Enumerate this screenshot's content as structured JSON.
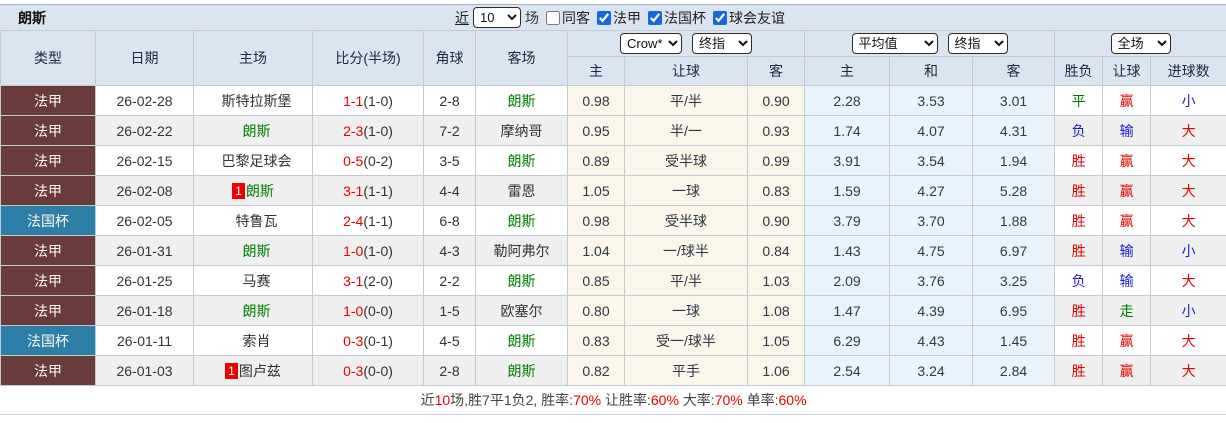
{
  "title": "朗斯",
  "topbar": {
    "recent_label": "近",
    "recent_value": "10",
    "matches_label": "场",
    "checkboxes": [
      {
        "key": "same-away",
        "label": "同客",
        "checked": false
      },
      {
        "key": "ligue-1",
        "label": "法甲",
        "checked": true
      },
      {
        "key": "coupe-de-france",
        "label": "法国杯",
        "checked": true
      },
      {
        "key": "club-friendly",
        "label": "球会友谊",
        "checked": true
      }
    ]
  },
  "selectors": {
    "asian_bookmaker": "Crow*",
    "asian_time": "终指",
    "euro_bookmaker": "平均值",
    "euro_time": "终指",
    "scope": "全场"
  },
  "columns": {
    "main": [
      "类型",
      "日期",
      "主场",
      "比分(半场)",
      "角球",
      "客场"
    ],
    "asian": [
      "主",
      "让球",
      "客"
    ],
    "euro": [
      "主",
      "和",
      "客"
    ],
    "result": [
      "胜负",
      "让球",
      "进球数"
    ]
  },
  "theme": {
    "league_colors": {
      "法甲": "#693b3b",
      "法国杯": "#2e7fa7"
    },
    "result_colors": {
      "red": "#e80000",
      "blue": "#1b1bd0",
      "green": "#007800"
    },
    "header_bg": "#dbe5f1",
    "asian_bg": "#fbf6ea",
    "euro_bg": "#e9f3fb",
    "alt_row_bg": "#efefef"
  },
  "rows": [
    {
      "type": "法甲",
      "date": "26-02-28",
      "home": {
        "name": "斯特拉斯堡",
        "self": false,
        "badge": null
      },
      "score": "1-1",
      "half": "(1-0)",
      "corners": "2-8",
      "away": {
        "name": "朗斯",
        "self": true
      },
      "ah": [
        "0.98",
        "平/半",
        "0.90"
      ],
      "eu": [
        "2.28",
        "3.53",
        "3.01"
      ],
      "res": [
        [
          "平",
          "green"
        ],
        [
          "赢",
          "red"
        ],
        [
          "小",
          "blue"
        ]
      ]
    },
    {
      "type": "法甲",
      "date": "26-02-22",
      "home": {
        "name": "朗斯",
        "self": true,
        "badge": null
      },
      "score": "2-3",
      "half": "(1-0)",
      "corners": "7-2",
      "away": {
        "name": "摩纳哥",
        "self": false
      },
      "ah": [
        "0.95",
        "半/一",
        "0.93"
      ],
      "eu": [
        "1.74",
        "4.07",
        "4.31"
      ],
      "res": [
        [
          "负",
          "blue"
        ],
        [
          "输",
          "blue"
        ],
        [
          "大",
          "red"
        ]
      ]
    },
    {
      "type": "法甲",
      "date": "26-02-15",
      "home": {
        "name": "巴黎足球会",
        "self": false,
        "badge": null
      },
      "score": "0-5",
      "half": "(0-2)",
      "corners": "3-5",
      "away": {
        "name": "朗斯",
        "self": true
      },
      "ah": [
        "0.89",
        "受半球",
        "0.99"
      ],
      "eu": [
        "3.91",
        "3.54",
        "1.94"
      ],
      "res": [
        [
          "胜",
          "red"
        ],
        [
          "赢",
          "red"
        ],
        [
          "大",
          "red"
        ]
      ]
    },
    {
      "type": "法甲",
      "date": "26-02-08",
      "home": {
        "name": "朗斯",
        "self": true,
        "badge": "1"
      },
      "score": "3-1",
      "half": "(1-1)",
      "corners": "4-4",
      "away": {
        "name": "雷恩",
        "self": false
      },
      "ah": [
        "1.05",
        "一球",
        "0.83"
      ],
      "eu": [
        "1.59",
        "4.27",
        "5.28"
      ],
      "res": [
        [
          "胜",
          "red"
        ],
        [
          "赢",
          "red"
        ],
        [
          "大",
          "red"
        ]
      ]
    },
    {
      "type": "法国杯",
      "date": "26-02-05",
      "home": {
        "name": "特鲁瓦",
        "self": false,
        "badge": null
      },
      "score": "2-4",
      "half": "(1-1)",
      "corners": "6-8",
      "away": {
        "name": "朗斯",
        "self": true
      },
      "ah": [
        "0.98",
        "受半球",
        "0.90"
      ],
      "eu": [
        "3.79",
        "3.70",
        "1.88"
      ],
      "res": [
        [
          "胜",
          "red"
        ],
        [
          "赢",
          "red"
        ],
        [
          "大",
          "red"
        ]
      ]
    },
    {
      "type": "法甲",
      "date": "26-01-31",
      "home": {
        "name": "朗斯",
        "self": true,
        "badge": null
      },
      "score": "1-0",
      "half": "(1-0)",
      "corners": "4-3",
      "away": {
        "name": "勒阿弗尔",
        "self": false
      },
      "ah": [
        "1.04",
        "一/球半",
        "0.84"
      ],
      "eu": [
        "1.43",
        "4.75",
        "6.97"
      ],
      "res": [
        [
          "胜",
          "red"
        ],
        [
          "输",
          "blue"
        ],
        [
          "小",
          "blue"
        ]
      ]
    },
    {
      "type": "法甲",
      "date": "26-01-25",
      "home": {
        "name": "马赛",
        "self": false,
        "badge": null
      },
      "score": "3-1",
      "half": "(2-0)",
      "corners": "2-2",
      "away": {
        "name": "朗斯",
        "self": true
      },
      "ah": [
        "0.85",
        "平/半",
        "1.03"
      ],
      "eu": [
        "2.09",
        "3.76",
        "3.25"
      ],
      "res": [
        [
          "负",
          "blue"
        ],
        [
          "输",
          "blue"
        ],
        [
          "大",
          "red"
        ]
      ]
    },
    {
      "type": "法甲",
      "date": "26-01-18",
      "home": {
        "name": "朗斯",
        "self": true,
        "badge": null
      },
      "score": "1-0",
      "half": "(0-0)",
      "corners": "1-5",
      "away": {
        "name": "欧塞尔",
        "self": false
      },
      "ah": [
        "0.80",
        "一球",
        "1.08"
      ],
      "eu": [
        "1.47",
        "4.39",
        "6.95"
      ],
      "res": [
        [
          "胜",
          "red"
        ],
        [
          "走",
          "green"
        ],
        [
          "小",
          "blue"
        ]
      ]
    },
    {
      "type": "法国杯",
      "date": "26-01-11",
      "home": {
        "name": "索肖",
        "self": false,
        "badge": null
      },
      "score": "0-3",
      "half": "(0-1)",
      "corners": "4-5",
      "away": {
        "name": "朗斯",
        "self": true
      },
      "ah": [
        "0.83",
        "受一/球半",
        "1.05"
      ],
      "eu": [
        "6.29",
        "4.43",
        "1.45"
      ],
      "res": [
        [
          "胜",
          "red"
        ],
        [
          "赢",
          "red"
        ],
        [
          "大",
          "red"
        ]
      ]
    },
    {
      "type": "法甲",
      "date": "26-01-03",
      "home": {
        "name": "图卢兹",
        "self": false,
        "badge": "1"
      },
      "score": "0-3",
      "half": "(0-0)",
      "corners": "2-8",
      "away": {
        "name": "朗斯",
        "self": true
      },
      "ah": [
        "0.82",
        "平手",
        "1.06"
      ],
      "eu": [
        "2.54",
        "3.24",
        "2.84"
      ],
      "res": [
        [
          "胜",
          "red"
        ],
        [
          "赢",
          "red"
        ],
        [
          "大",
          "red"
        ]
      ]
    }
  ],
  "footer": {
    "segments": [
      {
        "text": "近",
        "c": "dark"
      },
      {
        "text": "10",
        "c": "red"
      },
      {
        "text": "场,胜7平1负2, 胜率:",
        "c": "dark"
      },
      {
        "text": "70%",
        "c": "red"
      },
      {
        "text": " 让胜率:",
        "c": "dark"
      },
      {
        "text": "60%",
        "c": "red"
      },
      {
        "text": " 大率:",
        "c": "dark"
      },
      {
        "text": "70%",
        "c": "red"
      },
      {
        "text": " 单率:",
        "c": "dark"
      },
      {
        "text": "60%",
        "c": "red"
      }
    ]
  }
}
